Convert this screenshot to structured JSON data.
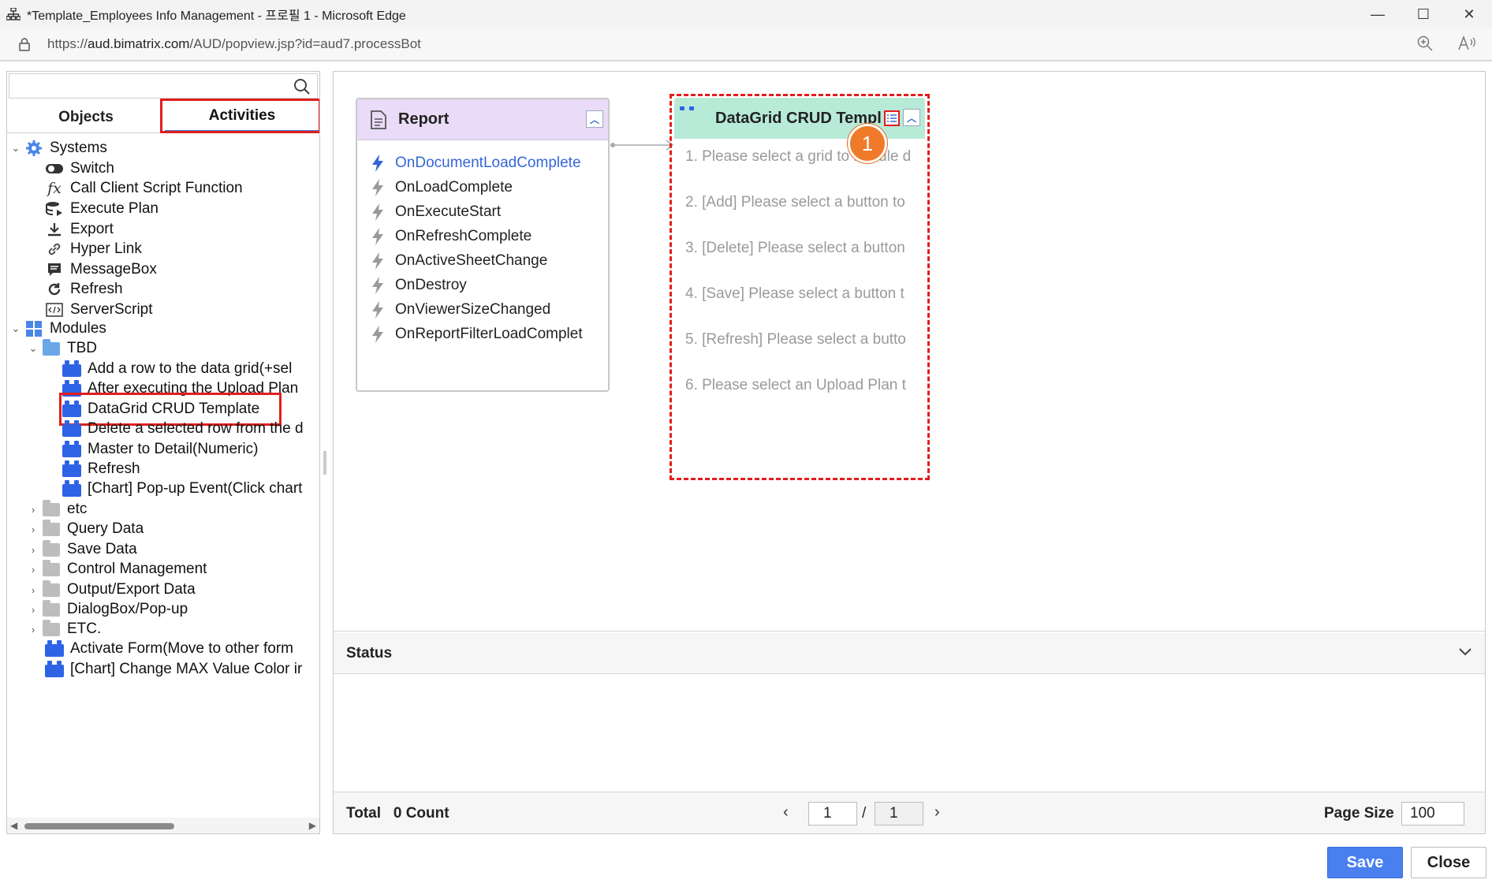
{
  "window": {
    "title": "*Template_Employees Info Management - 프로필 1 - Microsoft Edge",
    "url_prefix": "https://",
    "url_host": "aud.bimatrix.com",
    "url_path": "/AUD/popview.jsp?id=aud7.processBot",
    "minimize": "—",
    "maximize": "☐",
    "close": "✕"
  },
  "left": {
    "search_placeholder": "",
    "tabs": {
      "objects": "Objects",
      "activities": "Activities"
    },
    "tree": {
      "systems": "Systems",
      "switch": "Switch",
      "call_client": "Call Client Script Function",
      "execute_plan": "Execute Plan",
      "export": "Export",
      "hyper_link": "Hyper Link",
      "messagebox": "MessageBox",
      "refresh": "Refresh",
      "serverscript": "ServerScript",
      "modules": "Modules",
      "tbd": "TBD",
      "tbd_items": [
        "Add a row to the data grid(+sel",
        "After executing the Upload Plan",
        "DataGrid CRUD Template",
        "Delete a selected row from the d",
        "Master to Detail(Numeric)",
        "Refresh",
        "[Chart] Pop-up Event(Click chart"
      ],
      "etc": "etc",
      "query_data": "Query Data",
      "save_data": "Save Data",
      "control_management": "Control Management",
      "output_export": "Output/Export Data",
      "dialogbox": "DialogBox/Pop-up",
      "etc2": "ETC.",
      "activate_form": "Activate Form(Move to other form",
      "chart_change": "[Chart] Change MAX Value Color ir"
    }
  },
  "canvas": {
    "report": {
      "title": "Report",
      "events": [
        "OnDocumentLoadComplete",
        "OnLoadComplete",
        "OnExecuteStart",
        "OnRefreshComplete",
        "OnActiveSheetChange",
        "OnDestroy",
        "OnViewerSizeChanged",
        "OnReportFilterLoadComplet"
      ]
    },
    "datagrid": {
      "title": "DataGrid CRUD Templ",
      "steps": [
        "1. Please select a grid to handle d",
        "2. [Add] Please select a button to",
        "3. [Delete] Please select a button",
        "4. [Save] Please select a button t",
        "5. [Refresh] Please select a butto",
        "6. Please select an Upload Plan t"
      ]
    },
    "badge": "1"
  },
  "status": {
    "label": "Status"
  },
  "footer": {
    "total_label": "Total",
    "count": "0",
    "count_label": "Count",
    "page_current": "1",
    "page_sep": "/",
    "page_total": "1",
    "page_size_label": "Page Size",
    "page_size": "100"
  },
  "buttons": {
    "save": "Save",
    "close": "Close"
  },
  "colors": {
    "accent_red": "#e01e1e",
    "badge_orange": "#ee7a2a",
    "report_header": "#eadcf8",
    "datagrid_header": "#b8ead8",
    "event_active": "#3466d6",
    "save_blue": "#4a7ff0"
  }
}
